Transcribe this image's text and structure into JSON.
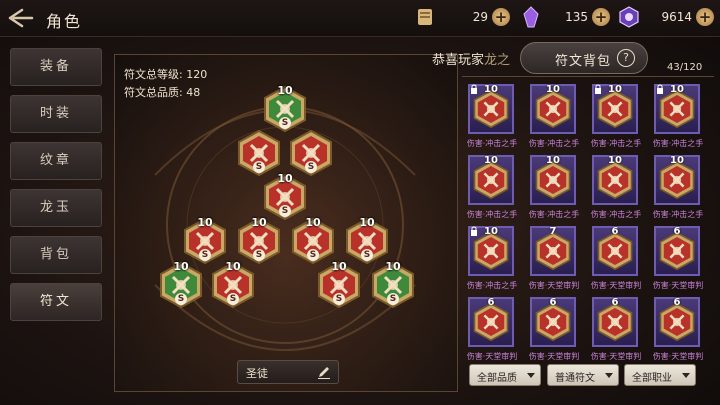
{
  "header": {
    "title": "角色",
    "resources": [
      {
        "icon": "scroll-icon",
        "value": "29"
      },
      {
        "icon": "crystal-icon",
        "value": "135"
      },
      {
        "icon": "gem-icon",
        "value": "9614"
      }
    ]
  },
  "sidebar": {
    "items": [
      {
        "label": "装备"
      },
      {
        "label": "时装"
      },
      {
        "label": "纹章"
      },
      {
        "label": "龙玉"
      },
      {
        "label": "背包"
      },
      {
        "label": "符文"
      }
    ],
    "active_index": 5
  },
  "rune_board": {
    "total_level_label": "符文总等级: 120",
    "total_quality_label": "符文总品质: 48",
    "slots": [
      {
        "level": "10",
        "color": "green",
        "grade": "S"
      },
      {
        "level": "",
        "color": "red",
        "grade": "S"
      },
      {
        "level": "",
        "color": "red",
        "grade": "S"
      },
      {
        "level": "10",
        "color": "red",
        "grade": "S"
      },
      {
        "level": "10",
        "color": "red",
        "grade": "S"
      },
      {
        "level": "10",
        "color": "red",
        "grade": "S"
      },
      {
        "level": "10",
        "color": "red",
        "grade": "S"
      },
      {
        "level": "10",
        "color": "red",
        "grade": "S"
      },
      {
        "level": "10",
        "color": "green",
        "grade": "S"
      },
      {
        "level": "10",
        "color": "red",
        "grade": "S"
      },
      {
        "level": "10",
        "color": "red",
        "grade": "S"
      },
      {
        "level": "10",
        "color": "green",
        "grade": "S"
      }
    ],
    "loadout_name": "圣徒"
  },
  "bag": {
    "player_name": "恭喜玩家",
    "player_name_faded": "龙之",
    "tab_label": "符文背包",
    "help_symbol": "?",
    "count": "43/120",
    "items": [
      {
        "level": "10",
        "locked": true,
        "name": "伤害·冲击之手"
      },
      {
        "level": "10",
        "locked": false,
        "name": "伤害·冲击之手"
      },
      {
        "level": "10",
        "locked": true,
        "name": "伤害·冲击之手"
      },
      {
        "level": "10",
        "locked": true,
        "name": "伤害·冲击之手"
      },
      {
        "level": "10",
        "locked": false,
        "name": "伤害·冲击之手"
      },
      {
        "level": "10",
        "locked": false,
        "name": "伤害·冲击之手"
      },
      {
        "level": "10",
        "locked": false,
        "name": "伤害·冲击之手"
      },
      {
        "level": "10",
        "locked": false,
        "name": "伤害·冲击之手"
      },
      {
        "level": "10",
        "locked": true,
        "name": "伤害·冲击之手"
      },
      {
        "level": "7",
        "locked": false,
        "name": "伤害·天堂审判"
      },
      {
        "level": "6",
        "locked": false,
        "name": "伤害·天堂审判"
      },
      {
        "level": "6",
        "locked": false,
        "name": "伤害·天堂审判"
      },
      {
        "level": "6",
        "locked": false,
        "name": "伤害·天堂审判"
      },
      {
        "level": "6",
        "locked": false,
        "name": "伤害·天堂审判"
      },
      {
        "level": "6",
        "locked": false,
        "name": "伤害·天堂审判"
      },
      {
        "level": "6",
        "locked": false,
        "name": "伤害·天堂审判"
      }
    ],
    "filters": [
      {
        "label": "全部品质"
      },
      {
        "label": "普通符文"
      },
      {
        "label": "全部职业"
      }
    ]
  },
  "colors": {
    "accent": "#c8a86a",
    "rune_red": "#b8322a",
    "rune_green": "#3f8a3a",
    "card_purple": "#4a3a78",
    "item_name": "#c883d6"
  }
}
